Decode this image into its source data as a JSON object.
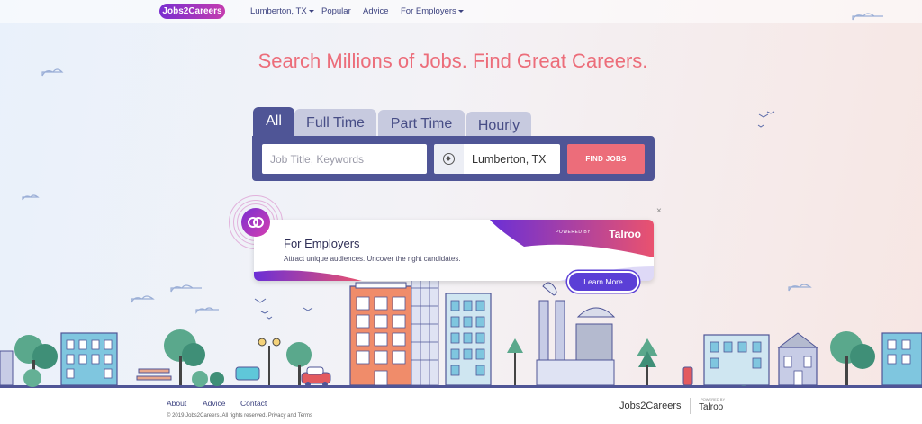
{
  "nav": {
    "logo": "Jobs2Careers",
    "location": "Lumberton, TX",
    "popular": "Popular",
    "advice": "Advice",
    "employers": "For Employers"
  },
  "headline": "Search Millions of Jobs. Find Great Careers.",
  "search": {
    "tabs": [
      "All",
      "Full Time",
      "Part Time",
      "Hourly"
    ],
    "active_tab": "All",
    "keyword_placeholder": "Job Title, Keywords",
    "location_value": "Lumberton, TX",
    "button": "FIND JOBS"
  },
  "employers_card": {
    "title": "For Employers",
    "subtitle": "Attract unique audiences. Uncover the right candidates.",
    "powered_by": "POWERED BY",
    "partner": "Talroo",
    "button": "Learn More",
    "close": "×"
  },
  "footer": {
    "links": [
      "About",
      "Advice",
      "Contact"
    ],
    "copyright": "© 2019 Jobs2Careers. All rights reserved. Privacy and Terms",
    "brand": "Jobs2Careers",
    "powered_by": "POWERED BY",
    "partner": "Talroo"
  },
  "colors": {
    "accent": "#ec6d7a",
    "navy": "#4f5596",
    "brand_purple": "#7a2fd0"
  }
}
